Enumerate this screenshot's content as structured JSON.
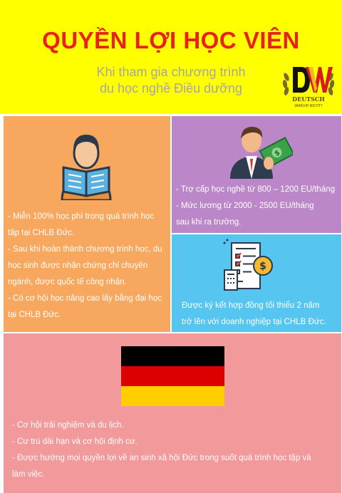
{
  "header": {
    "title": "QUYỀN LỢI HỌC VIÊN",
    "subtitle_line1": "Khi tham gia chương trình",
    "subtitle_line2": "du học nghề Điều dưỡng",
    "logo": {
      "brand": "DEUTSCH",
      "tagline": "WARUM NICHT?"
    }
  },
  "left_panel": {
    "icon": "student-reading-icon",
    "items": [
      "- Miễn 100% học phí trong quá trình học",
      "tập tại CHLB Đức.",
      "- Sau khi hoàn thành chương trình học, du",
      "học sinh được nhận chứng chỉ chuyên",
      "ngành, được quốc tế công nhận.",
      "- Có cơ hội học nâng cao lấy bằng đại học",
      "tại CHLB Đức."
    ]
  },
  "right_top_panel": {
    "icon": "businessman-money-icon",
    "items": [
      "- Trợ cấp học nghề từ 800 – 1200 EU/tháng",
      "- Mức lương từ 2000 - 2500 EU/tháng",
      "sau khi ra trường."
    ]
  },
  "right_bottom_panel": {
    "icon": "contract-coin-icon",
    "items": [
      "Được ký kết hợp đồng tối thiểu 2 năm",
      "trở lên với doanh nghiệp tại CHLB Đức."
    ]
  },
  "bottom_panel": {
    "icon": "germany-flag",
    "items": [
      "- Cơ hội trải nghiệm và du lịch.",
      "- Cư trú dài hạn và cơ hội định cư.",
      "- Được hưởng mọi quyền lợi về an sinh xã hội Đức trong suốt quá trình học tập và",
      "làm việc."
    ]
  },
  "colors": {
    "header_bg": "#ffff00",
    "title": "#e8211b",
    "subtitle": "#a6a6a6",
    "left_bg": "#f7a85e",
    "right_top_bg": "#bc87c9",
    "right_bottom_bg": "#56c6f0",
    "bottom_bg": "#f2999c",
    "flag": [
      "#000000",
      "#dd0000",
      "#ffce00"
    ]
  }
}
